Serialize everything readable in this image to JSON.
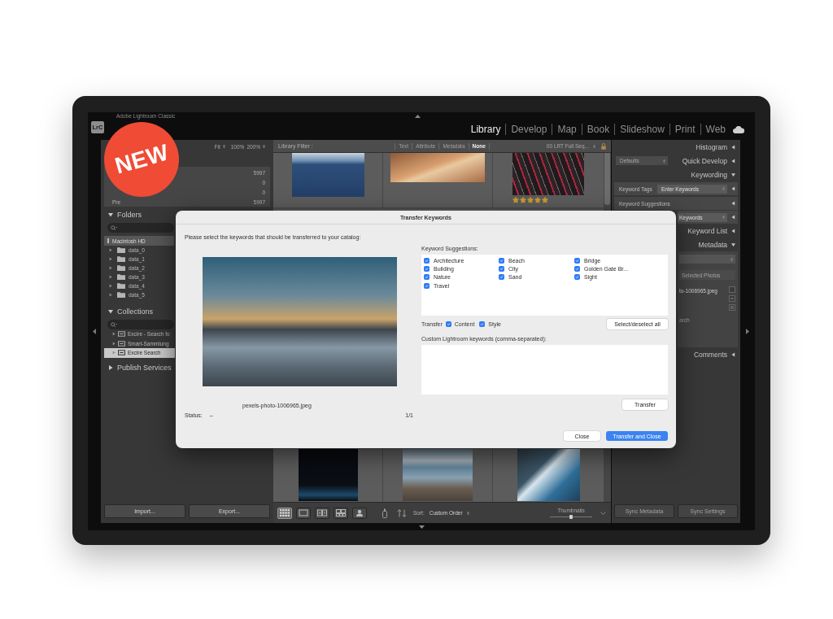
{
  "badge": {
    "text": "NEW"
  },
  "title_bar": {
    "logo": "LrC",
    "identity": "Adobe Lightroom Classic",
    "modules": [
      {
        "label": "Library",
        "selected": true
      },
      {
        "label": "Develop",
        "selected": false
      },
      {
        "label": "Map",
        "selected": false
      },
      {
        "label": "Book",
        "selected": false
      },
      {
        "label": "Slideshow",
        "selected": false
      },
      {
        "label": "Print",
        "selected": false
      },
      {
        "label": "Web",
        "selected": false
      }
    ]
  },
  "left_panel": {
    "navigator": {
      "zoom_options": [
        "Fit",
        "100%",
        "200%"
      ]
    },
    "catalog": [
      {
        "count": "5997"
      },
      {
        "count": "0"
      },
      {
        "count": "0"
      },
      {
        "label": "Pre",
        "count": "5997"
      }
    ],
    "folders": {
      "title": "Folders",
      "expanded": true,
      "volume": "Macintosh HD",
      "items": [
        {
          "name": "data_0",
          "expanded": false
        },
        {
          "name": "data_1",
          "expanded": false
        },
        {
          "name": "data_2",
          "expanded": false
        },
        {
          "name": "data_3",
          "expanded": false
        },
        {
          "name": "data_4",
          "expanded": false
        },
        {
          "name": "data_5",
          "expanded": false
        }
      ]
    },
    "collections": {
      "title": "Collections",
      "expanded": true,
      "items": [
        {
          "name": "Excire - Search fo",
          "expanded": false,
          "selected": false
        },
        {
          "name": "Smart-Sammlung",
          "expanded": false,
          "selected": false
        },
        {
          "name": "Excire Search",
          "expanded": false,
          "selected": true
        }
      ]
    },
    "publish_services": {
      "title": "Publish Services",
      "expanded": false
    },
    "buttons": [
      "Import...",
      "Export..."
    ]
  },
  "library": {
    "filter_bar": {
      "label": "Library Filter :",
      "filters": [
        {
          "label": "Text",
          "selected": false
        },
        {
          "label": "Attribute",
          "selected": false
        },
        {
          "label": "Metadata",
          "selected": false
        },
        {
          "label": "None",
          "selected": true
        }
      ],
      "preset": "00 LRT Full Seq..."
    },
    "grid": {
      "top_row": [
        {
          "kind": "lake"
        },
        {
          "kind": "dunes"
        },
        {
          "kind": "trails",
          "stars": 5
        }
      ],
      "bottom_row": [
        {
          "kind": "night"
        },
        {
          "kind": "pier"
        },
        {
          "kind": "waterfall"
        }
      ]
    },
    "toolbar": {
      "view_modes": [
        {
          "kind": "grid",
          "selected": true
        },
        {
          "kind": "loupe",
          "selected": false
        },
        {
          "kind": "compare",
          "selected": false
        },
        {
          "kind": "survey",
          "selected": false
        },
        {
          "kind": "people",
          "selected": false
        }
      ],
      "sort_label": "Sort:",
      "sort_value": "Custom Order",
      "thumbnails_label": "Thumbnails",
      "thumbnail_size": {
        "level": 0.5
      }
    }
  },
  "right_panel": {
    "rows": [
      {
        "kind": "header",
        "title": "Histogram",
        "expanded": false
      },
      {
        "kind": "header",
        "title": "Quick Develop",
        "expanded": false,
        "preset": "Defaults"
      },
      {
        "kind": "header",
        "title": "Keywording",
        "expanded": true
      },
      {
        "kind": "field",
        "label": "Keyword Tags",
        "value": "Enter Keywords"
      },
      {
        "kind": "subheader",
        "title": "Keyword Suggestions",
        "expanded": false
      },
      {
        "kind": "field",
        "value": "Keywords"
      },
      {
        "kind": "header",
        "title": "Keyword List",
        "expanded": false
      },
      {
        "kind": "header",
        "title": "Metadata",
        "expanded": true
      },
      {
        "kind": "metadata",
        "preset_label": "Selected Photos",
        "file_name": "to-1006965.jpeg",
        "caption": "arch"
      },
      {
        "kind": "header",
        "title": "Comments",
        "expanded": false
      }
    ],
    "buttons": [
      {
        "label": "Sync Metadata",
        "disabled": true
      },
      {
        "label": "Sync Settings",
        "disabled": true
      }
    ]
  },
  "dialog": {
    "title": "Transfer Keywords",
    "instruction": "Please select the keywords that should be transferred to your catalog:",
    "file_name": "pexels-photo-1006965.jpeg",
    "status_label": "Status:",
    "status_value": "–",
    "counter": "1/1",
    "suggestions_label": "Keyword Suggestions:",
    "keywords": [
      {
        "label": "Architecture",
        "checked": true
      },
      {
        "label": "Beach",
        "checked": true
      },
      {
        "label": "Bridge",
        "checked": true
      },
      {
        "label": "Building",
        "checked": true
      },
      {
        "label": "City",
        "checked": true
      },
      {
        "label": "Golden Gate Br...",
        "checked": true
      },
      {
        "label": "Nature",
        "checked": true
      },
      {
        "label": "Sand",
        "checked": true
      },
      {
        "label": "Sight",
        "checked": true
      },
      {
        "label": "Travel",
        "checked": true
      }
    ],
    "transfer_label": "Transfer",
    "transfer_options": [
      {
        "label": "Content",
        "checked": true
      },
      {
        "label": "Style",
        "checked": true
      }
    ],
    "select_all_button": "Select/deselect all",
    "custom_label": "Custom Lightroom keywords (comma-separated):",
    "transfer_button": "Transfer",
    "buttons": [
      {
        "label": "Close",
        "kind": "secondary"
      },
      {
        "label": "Transfer and Close",
        "kind": "primary"
      }
    ]
  }
}
